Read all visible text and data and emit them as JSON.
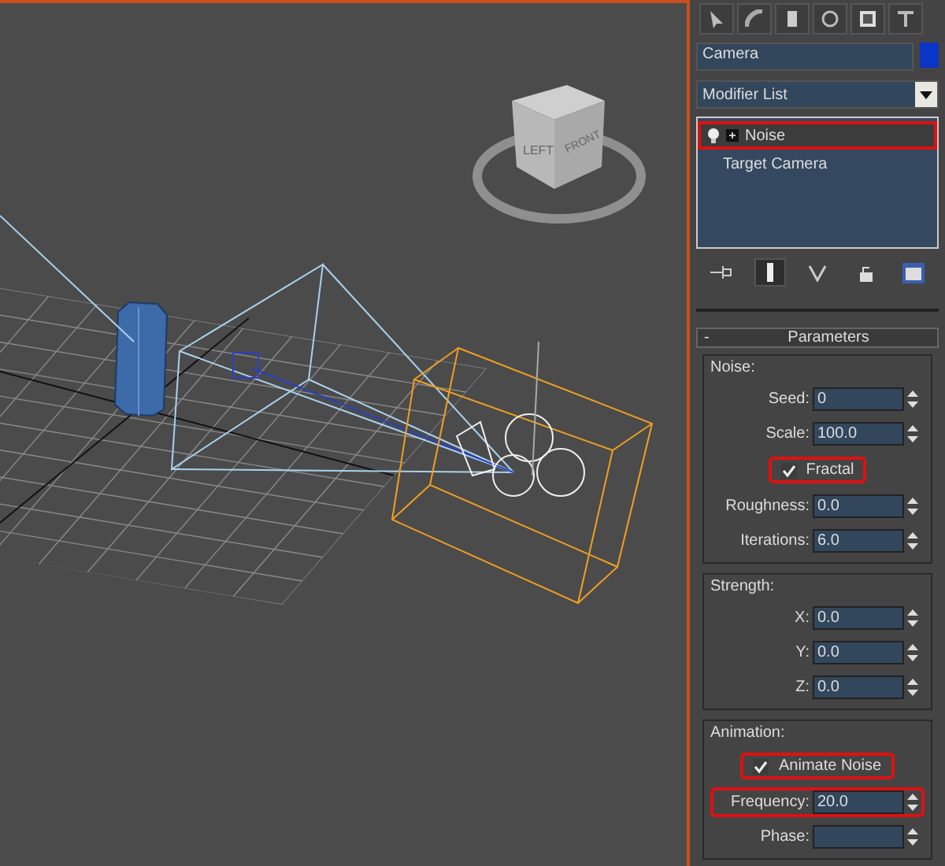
{
  "viewport": {
    "viewcube_labels": [
      "LEFT",
      "FRONT"
    ]
  },
  "command_panel": {
    "object_name": "Camera",
    "modifier_list": "Modifier List",
    "stack": [
      {
        "kind": "modifier",
        "label": "Noise",
        "highlighted": true
      },
      {
        "kind": "base",
        "label": "Target Camera",
        "highlighted": false
      }
    ],
    "rollout": {
      "toggle": "-",
      "title": "Parameters",
      "groups": [
        {
          "title": "Noise:",
          "rows": [
            {
              "kind": "spinner",
              "label": "Seed:",
              "value": "0",
              "highlighted": false
            },
            {
              "kind": "spinner",
              "label": "Scale:",
              "value": "100.0",
              "highlighted": false
            },
            {
              "kind": "checkbox",
              "label": "Fractal",
              "checked": true,
              "highlighted": true
            },
            {
              "kind": "spinner",
              "label": "Roughness:",
              "value": "0.0",
              "highlighted": false
            },
            {
              "kind": "spinner",
              "label": "Iterations:",
              "value": "6.0",
              "highlighted": false
            }
          ]
        },
        {
          "title": "Strength:",
          "rows": [
            {
              "kind": "spinner",
              "label": "X:",
              "value": "0.0",
              "highlighted": false
            },
            {
              "kind": "spinner",
              "label": "Y:",
              "value": "0.0",
              "highlighted": false
            },
            {
              "kind": "spinner",
              "label": "Z:",
              "value": "0.0",
              "highlighted": false
            }
          ]
        },
        {
          "title": "Animation:",
          "rows": [
            {
              "kind": "checkbox",
              "label": "Animate Noise",
              "checked": true,
              "highlighted": true
            },
            {
              "kind": "spinner",
              "label": "Frequency:",
              "value": "20.0",
              "highlighted": true
            },
            {
              "kind": "spinner",
              "label": "Phase:",
              "highlighted": false
            }
          ]
        }
      ]
    }
  }
}
